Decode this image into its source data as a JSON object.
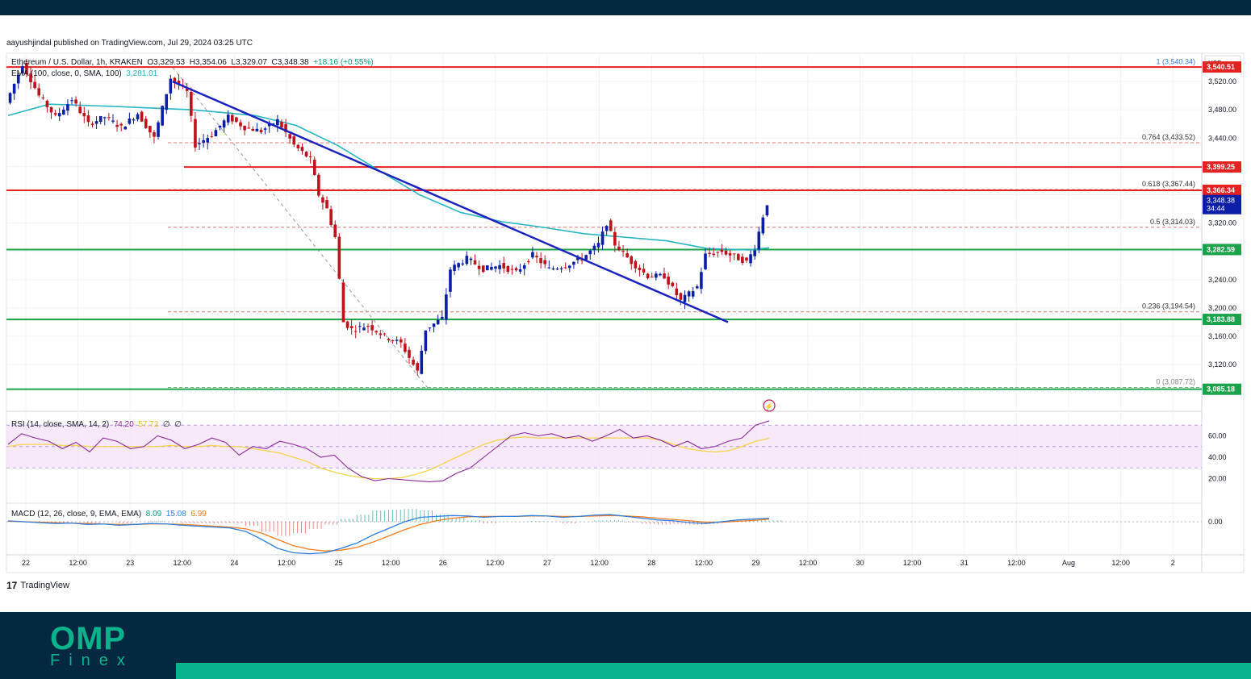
{
  "publisher": "aayushjindal published on TradingView.com, Jul 29, 2024 03:25 UTC",
  "legend": {
    "symbol": "Ethereum / U.S. Dollar, 1h, KRAKEN",
    "o": "O3,329.53",
    "h": "H3,354.06",
    "l": "L3,329.07",
    "c": "C3,348.38",
    "chg": "+18.16 (+0.55%)",
    "ema_label": "EMA (100, close, 0, SMA, 100)",
    "ema_value": "3,281.01",
    "rsi_label": "RSI (14, close, SMA, 14, 2)",
    "rsi_v1": "74.20",
    "rsi_v2": "57.72",
    "rsi_v3": "∅",
    "rsi_v4": "∅",
    "macd_label": "MACD (12, 26, close, 9, EMA, EMA)",
    "macd_v1": "8.09",
    "macd_v2": "15.08",
    "macd_v3": "6.99"
  },
  "currency": "USD",
  "brand": {
    "name": "OMP",
    "sub": "Finex",
    "tv": "TradingView"
  },
  "colors": {
    "up": "#0b1ea8",
    "down": "#c0101a",
    "ema": "#26b6c4",
    "trendline": "#1a22c0",
    "resistance": "#e52222",
    "support": "#1aa34a",
    "rsi": "#8e2a9e",
    "rsi_ma": "#f5d44a",
    "macd": "#2f7fe0",
    "signal": "#f57c22",
    "header": "#03283f",
    "accent": "#09b38c"
  },
  "chart_data": {
    "type": "candlestick",
    "ylim": [
      3070,
      3560
    ],
    "y_ticks": [
      "3,520.00",
      "3,480.00",
      "3,440.00",
      "3,400.00",
      "3,360.00",
      "3,320.00",
      "3,280.00",
      "3,240.00",
      "3,200.00",
      "3,160.00",
      "3,120.00"
    ],
    "y_tick_values": [
      3520,
      3480,
      3440,
      3400,
      3360,
      3320,
      3280,
      3240,
      3200,
      3160,
      3120
    ],
    "x_ticks": [
      "22",
      "12:00",
      "23",
      "12:00",
      "24",
      "12:00",
      "25",
      "12:00",
      "26",
      "12:00",
      "27",
      "12:00",
      "28",
      "12:00",
      "29",
      "12:00",
      "30",
      "12:00",
      "31",
      "12:00",
      "Aug",
      "12:00",
      "2"
    ],
    "price_points": [
      {
        "t": 0,
        "p": 3490
      },
      {
        "t": 3,
        "p": 3530
      },
      {
        "t": 4,
        "p": 3545
      },
      {
        "t": 8,
        "p": 3500
      },
      {
        "t": 12,
        "p": 3470
      },
      {
        "t": 16,
        "p": 3495
      },
      {
        "t": 20,
        "p": 3460
      },
      {
        "t": 24,
        "p": 3470
      },
      {
        "t": 28,
        "p": 3455
      },
      {
        "t": 32,
        "p": 3475
      },
      {
        "t": 36,
        "p": 3440
      },
      {
        "t": 40,
        "p": 3525
      },
      {
        "t": 44,
        "p": 3505
      },
      {
        "t": 46,
        "p": 3430
      },
      {
        "t": 50,
        "p": 3445
      },
      {
        "t": 54,
        "p": 3470
      },
      {
        "t": 58,
        "p": 3455
      },
      {
        "t": 62,
        "p": 3450
      },
      {
        "t": 66,
        "p": 3465
      },
      {
        "t": 70,
        "p": 3430
      },
      {
        "t": 74,
        "p": 3410
      },
      {
        "t": 76,
        "p": 3360
      },
      {
        "t": 78,
        "p": 3340
      },
      {
        "t": 80,
        "p": 3300
      },
      {
        "t": 82,
        "p": 3180
      },
      {
        "t": 84,
        "p": 3170
      },
      {
        "t": 88,
        "p": 3175
      },
      {
        "t": 92,
        "p": 3160
      },
      {
        "t": 96,
        "p": 3150
      },
      {
        "t": 100,
        "p": 3110
      },
      {
        "t": 102,
        "p": 3170
      },
      {
        "t": 106,
        "p": 3185
      },
      {
        "t": 108,
        "p": 3255
      },
      {
        "t": 112,
        "p": 3270
      },
      {
        "t": 116,
        "p": 3255
      },
      {
        "t": 120,
        "p": 3260
      },
      {
        "t": 124,
        "p": 3250
      },
      {
        "t": 128,
        "p": 3275
      },
      {
        "t": 132,
        "p": 3255
      },
      {
        "t": 136,
        "p": 3260
      },
      {
        "t": 140,
        "p": 3270
      },
      {
        "t": 144,
        "p": 3290
      },
      {
        "t": 146,
        "p": 3320
      },
      {
        "t": 148,
        "p": 3290
      },
      {
        "t": 152,
        "p": 3265
      },
      {
        "t": 156,
        "p": 3245
      },
      {
        "t": 160,
        "p": 3245
      },
      {
        "t": 164,
        "p": 3210
      },
      {
        "t": 168,
        "p": 3230
      },
      {
        "t": 170,
        "p": 3275
      },
      {
        "t": 174,
        "p": 3280
      },
      {
        "t": 178,
        "p": 3270
      },
      {
        "t": 180,
        "p": 3265
      },
      {
        "t": 182,
        "p": 3285
      },
      {
        "t": 184,
        "p": 3330
      },
      {
        "t": 185,
        "p": 3348
      }
    ],
    "last_price": 3348.38,
    "ema100": [
      {
        "t": 0,
        "p": 3472
      },
      {
        "t": 10,
        "p": 3488
      },
      {
        "t": 25,
        "p": 3485
      },
      {
        "t": 45,
        "p": 3480
      },
      {
        "t": 60,
        "p": 3472
      },
      {
        "t": 70,
        "p": 3458
      },
      {
        "t": 80,
        "p": 3430
      },
      {
        "t": 90,
        "p": 3395
      },
      {
        "t": 100,
        "p": 3360
      },
      {
        "t": 110,
        "p": 3335
      },
      {
        "t": 120,
        "p": 3322
      },
      {
        "t": 130,
        "p": 3314
      },
      {
        "t": 140,
        "p": 3305
      },
      {
        "t": 150,
        "p": 3300
      },
      {
        "t": 160,
        "p": 3295
      },
      {
        "t": 170,
        "p": 3284
      },
      {
        "t": 180,
        "p": 3282
      },
      {
        "t": 185,
        "p": 3285
      }
    ],
    "horizontal_levels": [
      {
        "price": 3540.51,
        "label": "3,540.51",
        "kind": "resistance"
      },
      {
        "price": 3399.25,
        "label": "3,399.25",
        "kind": "resistance"
      },
      {
        "price": 3366.34,
        "label": "3,366.34",
        "kind": "resistance"
      },
      {
        "price": 3282.59,
        "label": "3,282.59",
        "kind": "support"
      },
      {
        "price": 3183.88,
        "label": "3,183.88",
        "kind": "support"
      },
      {
        "price": 3085.18,
        "label": "3,085.18",
        "kind": "support"
      }
    ],
    "fib_levels": [
      {
        "price": 3540.34,
        "label": "1 (3,540.34)"
      },
      {
        "price": 3433.52,
        "label": "0.764 (3,433.52)"
      },
      {
        "price": 3367.44,
        "label": "0.618 (3,367.44)"
      },
      {
        "price": 3314.03,
        "label": "0.5 (3,314.03)"
      },
      {
        "price": 3194.54,
        "label": "0.236 (3,194.54)"
      },
      {
        "price": 3087.72,
        "label": "0 (3,087.72)"
      }
    ],
    "trendline": {
      "from": {
        "t": 40,
        "p": 3520
      },
      "to": {
        "t": 175,
        "p": 3180
      }
    },
    "last_label": "3,348.38",
    "countdown": "34:44",
    "rsi": {
      "ticks": [
        "60.00",
        "40.00",
        "20.00"
      ],
      "tick_values": [
        60,
        40,
        20
      ],
      "band": [
        30,
        70
      ],
      "values": [
        52,
        62,
        58,
        55,
        48,
        54,
        45,
        58,
        55,
        48,
        50,
        60,
        56,
        48,
        52,
        58,
        54,
        42,
        50,
        48,
        55,
        52,
        48,
        40,
        42,
        30,
        22,
        18,
        20,
        19,
        18,
        17,
        18,
        25,
        30,
        40,
        50,
        60,
        63,
        60,
        62,
        58,
        60,
        55,
        60,
        66,
        58,
        60,
        56,
        50,
        55,
        48,
        50,
        55,
        58,
        70,
        74
      ]
    },
    "rsi_ma": [
      50,
      52,
      52,
      52,
      51,
      51,
      50,
      50,
      50,
      50,
      50,
      50,
      51,
      50,
      50,
      51,
      50,
      50,
      48,
      46,
      44,
      40,
      36,
      30,
      26,
      23,
      21,
      20,
      20,
      21,
      24,
      28,
      34,
      40,
      46,
      52,
      56,
      58,
      59,
      58,
      58,
      58,
      58,
      58,
      58,
      58,
      58,
      58,
      56,
      52,
      48,
      46,
      45,
      46,
      50,
      55,
      57.72
    ],
    "macd": {
      "zero_label": "0.00",
      "macd_values": [
        2,
        0,
        -2,
        -4,
        -3,
        -6,
        -5,
        -8,
        -6,
        -4,
        -5,
        -8,
        -10,
        -12,
        -14,
        -22,
        -40,
        -60,
        -70,
        -72,
        -70,
        -60,
        -48,
        -30,
        -15,
        0,
        10,
        12,
        14,
        13,
        10,
        12,
        12,
        14,
        13,
        10,
        12,
        15,
        16,
        12,
        8,
        4,
        2,
        -2,
        -4,
        0,
        4,
        6,
        8
      ],
      "signal_values": [
        1,
        0,
        -1,
        -2,
        -3,
        -4,
        -5,
        -6,
        -6,
        -5,
        -5,
        -6,
        -8,
        -10,
        -12,
        -16,
        -26,
        -40,
        -54,
        -62,
        -66,
        -64,
        -58,
        -46,
        -32,
        -18,
        -6,
        2,
        8,
        11,
        12,
        12,
        12,
        13,
        13,
        12,
        12,
        13,
        14,
        13,
        11,
        8,
        5,
        2,
        -1,
        -1,
        1,
        3,
        6
      ]
    }
  }
}
